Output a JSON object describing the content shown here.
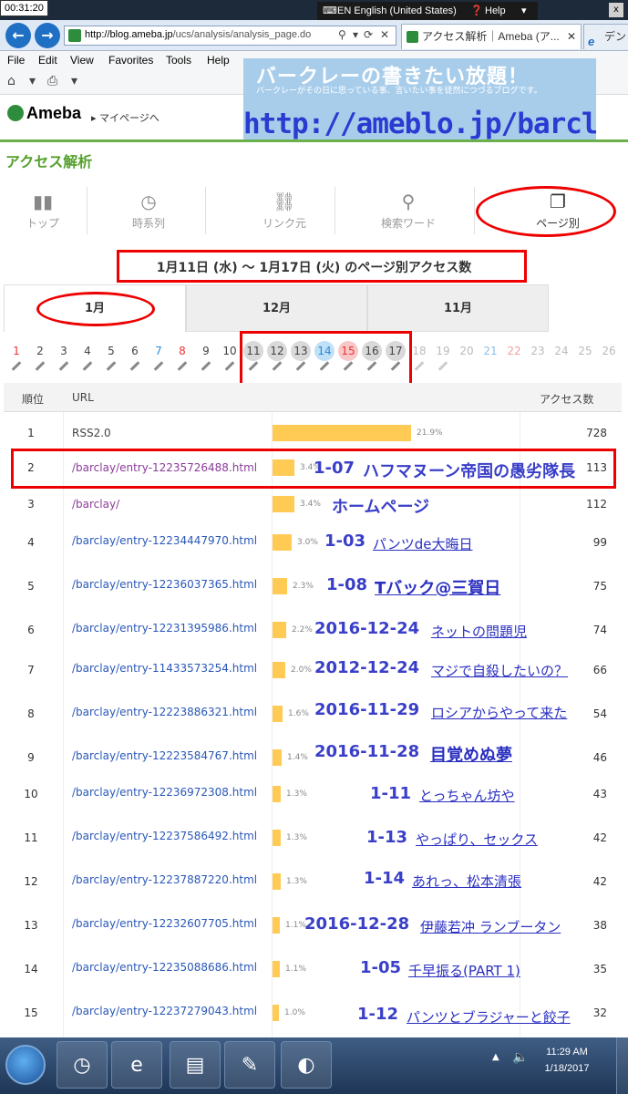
{
  "overlay_clock": "00:31:20",
  "window": {
    "language": "EN English (United States)",
    "help": "Help",
    "close": "x"
  },
  "browser": {
    "url_host": "http://blog.ameba.jp",
    "url_path": "/ucs/analysis/analysis_page.do",
    "active_tab": "アクセス解析｜Ameba (ア...",
    "other_tab": "デン"
  },
  "menu": [
    "File",
    "Edit",
    "View",
    "Favorites",
    "Tools",
    "Help"
  ],
  "banner": {
    "title": "バークレーの書きたい放題！",
    "subtitle": "バークレーがその日に思っている事、言いたい事を徒然につづるブログです。",
    "url": "http://ameblo.jp/barclay"
  },
  "ameba": {
    "logo": "Ameba",
    "mypage": "マイページへ",
    "page_title": "アクセス解析"
  },
  "nav": [
    {
      "label": "トップ",
      "icon": "bar-chart-icon"
    },
    {
      "label": "時系列",
      "icon": "clock-icon"
    },
    {
      "label": "リンク元",
      "icon": "link-icon"
    },
    {
      "label": "検索ワード",
      "icon": "search-icon"
    },
    {
      "label": "ページ別",
      "icon": "pages-icon"
    }
  ],
  "range_title": "1月11日 (水) 〜 1月17日 (火) のページ別アクセス数",
  "months": [
    "1月",
    "12月",
    "11月"
  ],
  "days": [
    "1",
    "2",
    "3",
    "4",
    "5",
    "6",
    "7",
    "8",
    "9",
    "10",
    "11",
    "12",
    "13",
    "14",
    "15",
    "16",
    "17",
    "18",
    "19",
    "20",
    "21",
    "22",
    "23",
    "24",
    "25",
    "26"
  ],
  "table": {
    "headers": {
      "rank": "順位",
      "url": "URL",
      "count": "アクセス数"
    },
    "rows": [
      {
        "rank": "1",
        "url": "RSS2.0",
        "pct": "21.9%",
        "pct_value": 21.9,
        "count": "728"
      },
      {
        "rank": "2",
        "url": "/barclay/entry-12235726488.html",
        "pct": "3.4%",
        "pct_value": 3.4,
        "count": "113"
      },
      {
        "rank": "3",
        "url": "/barclay/",
        "pct": "3.4%",
        "pct_value": 3.4,
        "count": "112"
      },
      {
        "rank": "4",
        "url": "/barclay/entry-12234447970.html",
        "pct": "3.0%",
        "pct_value": 3.0,
        "count": "99"
      },
      {
        "rank": "5",
        "url": "/barclay/entry-12236037365.html",
        "pct": "2.3%",
        "pct_value": 2.3,
        "count": "75"
      },
      {
        "rank": "6",
        "url": "/barclay/entry-12231395986.html",
        "pct": "2.2%",
        "pct_value": 2.2,
        "count": "74"
      },
      {
        "rank": "7",
        "url": "/barclay/entry-11433573254.html",
        "pct": "2.0%",
        "pct_value": 2.0,
        "count": "66"
      },
      {
        "rank": "8",
        "url": "/barclay/entry-12223886321.html",
        "pct": "1.6%",
        "pct_value": 1.6,
        "count": "54"
      },
      {
        "rank": "9",
        "url": "/barclay/entry-12223584767.html",
        "pct": "1.4%",
        "pct_value": 1.4,
        "count": "46"
      },
      {
        "rank": "10",
        "url": "/barclay/entry-12236972308.html",
        "pct": "1.3%",
        "pct_value": 1.3,
        "count": "43"
      },
      {
        "rank": "11",
        "url": "/barclay/entry-12237586492.html",
        "pct": "1.3%",
        "pct_value": 1.3,
        "count": "42"
      },
      {
        "rank": "12",
        "url": "/barclay/entry-12237887220.html",
        "pct": "1.3%",
        "pct_value": 1.3,
        "count": "42"
      },
      {
        "rank": "13",
        "url": "/barclay/entry-12232607705.html",
        "pct": "1.1%",
        "pct_value": 1.1,
        "count": "38"
      },
      {
        "rank": "14",
        "url": "/barclay/entry-12235088686.html",
        "pct": "1.1%",
        "pct_value": 1.1,
        "count": "35"
      },
      {
        "rank": "15",
        "url": "/barclay/entry-12237279043.html",
        "pct": "1.0%",
        "pct_value": 1.0,
        "count": "32"
      }
    ]
  },
  "annotations": [
    {
      "date": "1-07",
      "title": "ハフマヌーン帝国の愚劣隊長"
    },
    {
      "date": "",
      "title": "ホームページ"
    },
    {
      "date": "1-03",
      "title": "パンツde大晦日"
    },
    {
      "date": "1-08",
      "title": "Tバック@三賀日"
    },
    {
      "date": "2016-12-24",
      "title": "ネットの問題児"
    },
    {
      "date": "2012-12-24",
      "title": "マジで自殺したいの？"
    },
    {
      "date": "2016-11-29",
      "title": "ロシアからやって来た"
    },
    {
      "date": "2016-11-28",
      "title": "目覚めぬ夢"
    },
    {
      "date": "1-11",
      "title": "とっちゃん坊や"
    },
    {
      "date": "1-13",
      "title": "やっぱり、セックス"
    },
    {
      "date": "1-14",
      "title": "あれっ、松本清張"
    },
    {
      "date": "2016-12-28",
      "title": "伊藤若冲 ランブータン"
    },
    {
      "date": "1-05",
      "title": "千早振る(PART 1)"
    },
    {
      "date": "1-12",
      "title": "パンツとブラジャーと餃子"
    }
  ],
  "taskbar": {
    "time": "11:29 AM",
    "date": "1/18/2017"
  }
}
